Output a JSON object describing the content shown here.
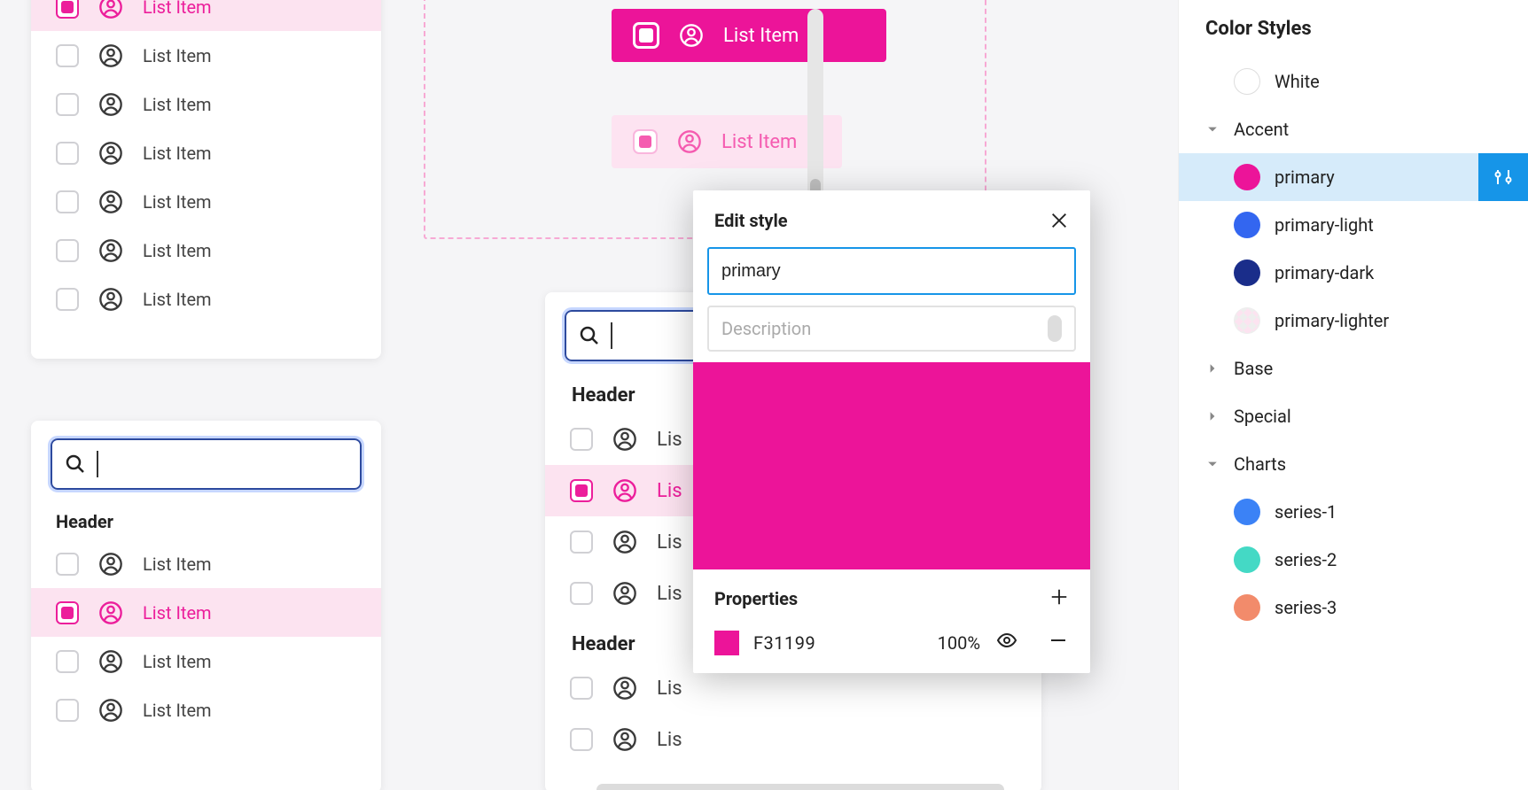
{
  "list_item_label": "List Item",
  "truncated_label": "Lis",
  "header_label": "Header",
  "search_value": "",
  "chip_solid_label": "List Item",
  "chip_light_label": "List Item",
  "popover": {
    "title": "Edit style",
    "name_value": "primary",
    "desc_placeholder": "Description",
    "props_label": "Properties",
    "hex": "F31199",
    "opacity": "100%"
  },
  "sidebar": {
    "title": "Color Styles",
    "white": "White",
    "groups": {
      "accent": "Accent",
      "base": "Base",
      "special": "Special",
      "charts": "Charts"
    },
    "accent_items": {
      "primary": "primary",
      "primary_light": "primary-light",
      "primary_dark": "primary-dark",
      "primary_lighter": "primary-lighter"
    },
    "chart_items": {
      "s1": "series-1",
      "s2": "series-2",
      "s3": "series-3"
    }
  },
  "colors": {
    "primary": "#ec1499",
    "primary_row_bg": "#fce3f0",
    "selection_blue": "#1695e8"
  }
}
